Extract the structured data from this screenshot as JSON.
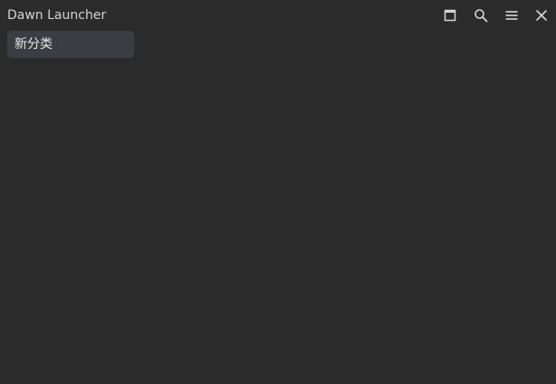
{
  "window": {
    "title": "Dawn Launcher",
    "background": "#2b2b2b"
  },
  "title_actions": [
    {
      "icon": "maximize-icon"
    },
    {
      "icon": "search-icon"
    },
    {
      "icon": "menu-icon"
    },
    {
      "icon": "close-icon"
    }
  ],
  "categories": [
    {
      "label": "新分类",
      "active": true
    }
  ],
  "colors": {
    "tab_background": "#3a3d42",
    "icon": "#d6d6d6"
  }
}
